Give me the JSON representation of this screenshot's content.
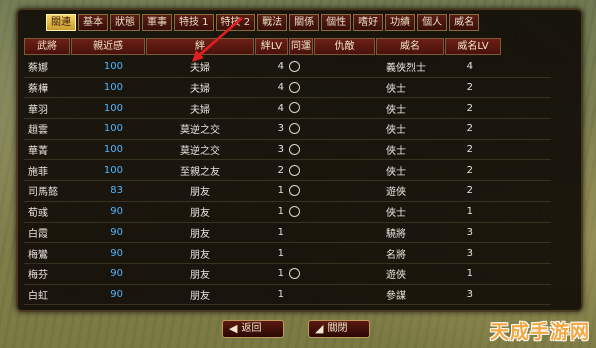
{
  "tabs": [
    "關連",
    "基本",
    "狀態",
    "軍事",
    "特技 1",
    "特技 2",
    "戰法",
    "關係",
    "個性",
    "嗜好",
    "功績",
    "個人",
    "威名"
  ],
  "headers": {
    "name": "武將",
    "affinity": "親近感",
    "bond": "絆",
    "bond_lvl": "絆LV",
    "fate": "同運",
    "enemy": "仇敵",
    "fame": "威名",
    "fame_lvl": "威名LV"
  },
  "rows": [
    {
      "name": "蔡娜",
      "affinity": "100",
      "bond": "夫婦",
      "bond_lvl": "4",
      "fate": true,
      "fame": "義俠烈士",
      "fame_lvl": "4"
    },
    {
      "name": "蔡樺",
      "affinity": "100",
      "bond": "夫婦",
      "bond_lvl": "4",
      "fate": true,
      "fame": "俠士",
      "fame_lvl": "2"
    },
    {
      "name": "華羽",
      "affinity": "100",
      "bond": "夫婦",
      "bond_lvl": "4",
      "fate": true,
      "fame": "俠士",
      "fame_lvl": "2"
    },
    {
      "name": "趙雲",
      "affinity": "100",
      "bond": "莫逆之交",
      "bond_lvl": "3",
      "fate": true,
      "fame": "俠士",
      "fame_lvl": "2"
    },
    {
      "name": "華菁",
      "affinity": "100",
      "bond": "莫逆之交",
      "bond_lvl": "3",
      "fate": true,
      "fame": "俠士",
      "fame_lvl": "2"
    },
    {
      "name": "施菲",
      "affinity": "100",
      "bond": "至親之友",
      "bond_lvl": "2",
      "fate": true,
      "fame": "俠士",
      "fame_lvl": "2"
    },
    {
      "name": "司馬懿",
      "affinity": "83",
      "bond": "朋友",
      "bond_lvl": "1",
      "fate": true,
      "fame": "遊俠",
      "fame_lvl": "2"
    },
    {
      "name": "荀彧",
      "affinity": "90",
      "bond": "朋友",
      "bond_lvl": "1",
      "fate": true,
      "fame": "俠士",
      "fame_lvl": "1"
    },
    {
      "name": "白霞",
      "affinity": "90",
      "bond": "朋友",
      "bond_lvl": "1",
      "fate": false,
      "fame": "驍將",
      "fame_lvl": "3"
    },
    {
      "name": "梅鸞",
      "affinity": "90",
      "bond": "朋友",
      "bond_lvl": "1",
      "fate": false,
      "fame": "名將",
      "fame_lvl": "3"
    },
    {
      "name": "梅芬",
      "affinity": "90",
      "bond": "朋友",
      "bond_lvl": "1",
      "fate": true,
      "fame": "遊俠",
      "fame_lvl": "1"
    },
    {
      "name": "白虹",
      "affinity": "90",
      "bond": "朋友",
      "bond_lvl": "1",
      "fate": false,
      "fame": "參謀",
      "fame_lvl": "3"
    }
  ],
  "buttons": {
    "back": "返回",
    "close": "關閉"
  },
  "watermark": "天成手游网",
  "colors": {
    "affinity": "#4fb4ff",
    "tab_active": "#e8c24a",
    "panel": "#0e0a06"
  }
}
